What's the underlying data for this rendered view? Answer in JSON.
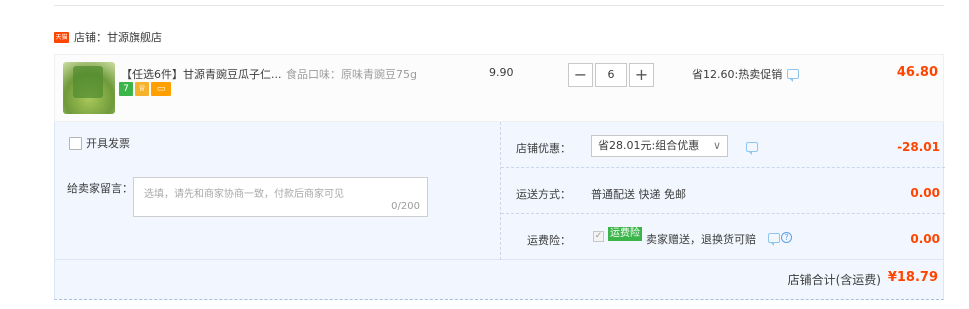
{
  "shop": {
    "icon": "tmall-icon",
    "label": "店铺：甘源旗舰店"
  },
  "item": {
    "title": "【任选6件】甘源青豌豆瓜子仁...",
    "spec": "食品口味：原味青豌豆75g",
    "badges": [
      "7",
      "",
      ""
    ],
    "unit_price": "9.90",
    "quantity": "6",
    "minus": "−",
    "plus": "+",
    "promo": "省12.60:热卖促销",
    "total": "46.80"
  },
  "invoice": {
    "label": "开具发票"
  },
  "memo": {
    "label": "给卖家留言：",
    "placeholder": "选填，请先和商家协商一致，付款后商家可见",
    "count": "0/200"
  },
  "shop_coupon": {
    "label": "店铺优惠：",
    "value": "省28.01元:组合优惠",
    "chevron": "∨",
    "amount": "-28.01"
  },
  "delivery": {
    "label": "运送方式：",
    "value": "普通配送 快递 免邮",
    "amount": "0.00"
  },
  "insurance": {
    "label": "运费险：",
    "tag": "运费险",
    "text": "卖家赠送，退换货可赔",
    "help": "?",
    "amount": "0.00"
  },
  "total": {
    "label": "店铺合计(含运费)",
    "value": "¥18.79"
  },
  "colors": {
    "accent": "#ff4400",
    "panel": "#f2f7ff",
    "badge_green": "#3bb54a"
  }
}
